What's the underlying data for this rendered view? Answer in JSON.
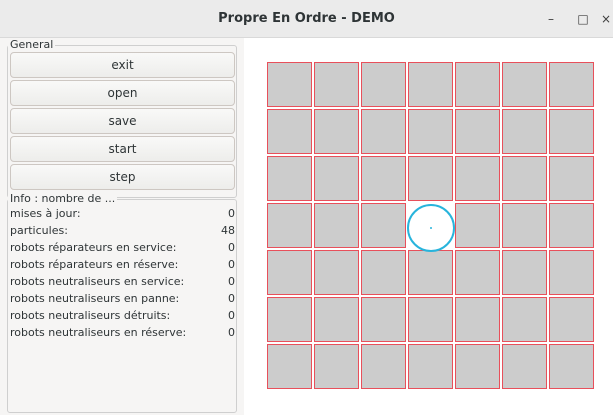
{
  "window": {
    "title": "Propre En Ordre - DEMO",
    "minimize_icon": "–",
    "maximize_icon": "□",
    "close_icon": "×"
  },
  "general": {
    "label": "General",
    "buttons": [
      "exit",
      "open",
      "save",
      "start",
      "step"
    ]
  },
  "info": {
    "label": "Info : nombre de ...",
    "rows": [
      {
        "label": "mises à jour:",
        "value": "0"
      },
      {
        "label": "particules:",
        "value": "48"
      },
      {
        "label": "robots réparateurs en service:",
        "value": "0"
      },
      {
        "label": "robots réparateurs en réserve:",
        "value": "0"
      },
      {
        "label": "robots neutraliseurs en service:",
        "value": "0"
      },
      {
        "label": "robots neutraliseurs en panne:",
        "value": "0"
      },
      {
        "label": "robots neutraliseurs détruits:",
        "value": "0"
      },
      {
        "label": "robots neutraliseurs en réserve:",
        "value": "0"
      }
    ]
  },
  "world": {
    "rows": 7,
    "cols": 7,
    "empty_cell": {
      "row": 3,
      "col": 3
    },
    "colors": {
      "particle_fill": "#cccccc",
      "particle_border": "#e8505b",
      "robot": "#28b4dc",
      "background": "#ffffff"
    }
  }
}
